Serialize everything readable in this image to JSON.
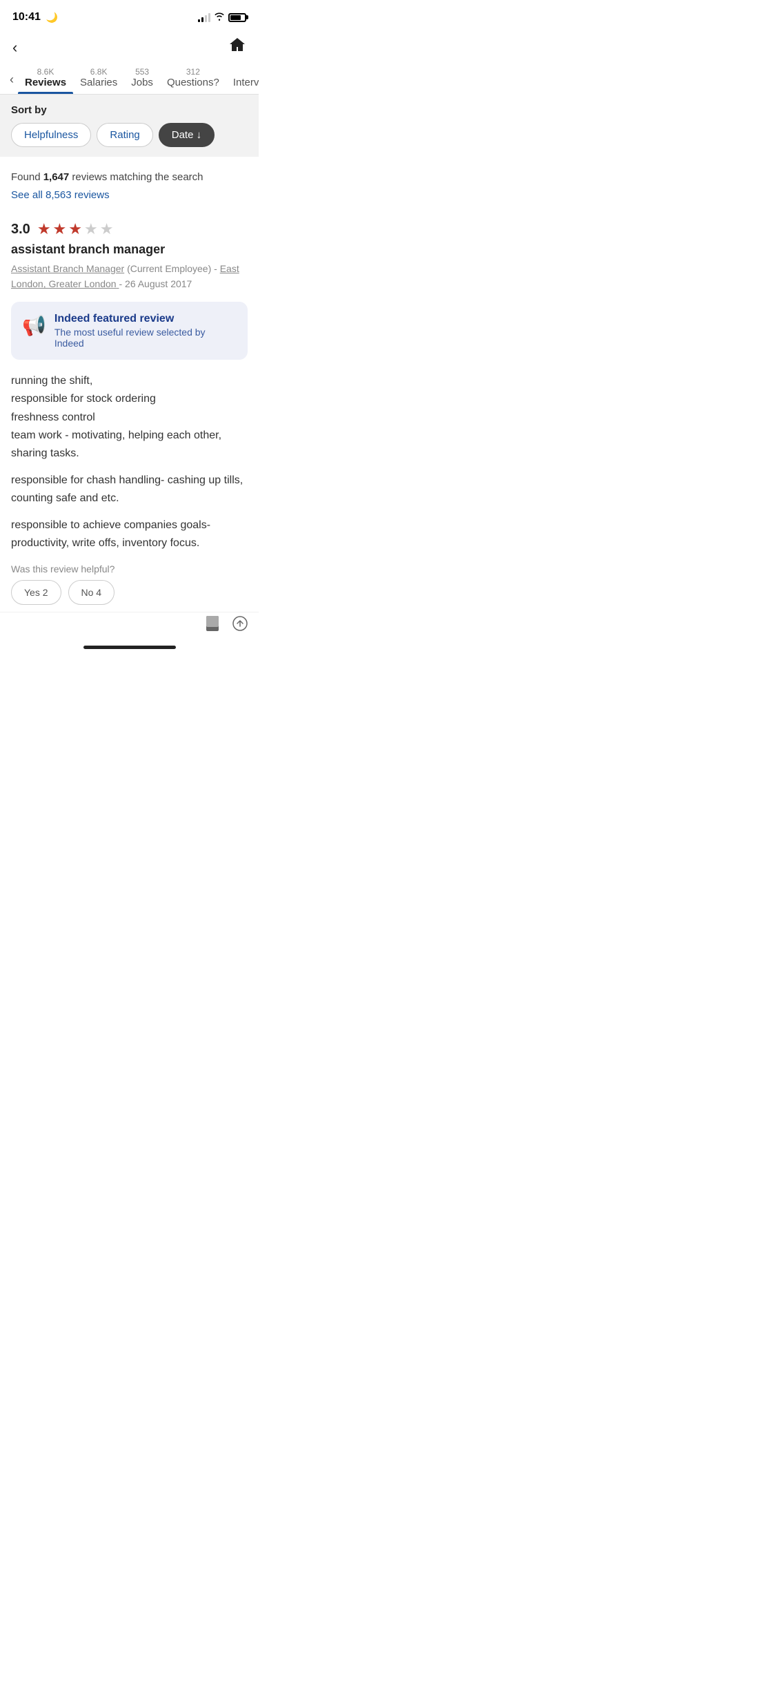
{
  "statusBar": {
    "time": "10:41",
    "moonIcon": "🌙"
  },
  "nav": {
    "backLabel": "‹",
    "homeIcon": "⌂"
  },
  "tabs": {
    "leftArrowLabel": "‹",
    "rightArrowLabel": "›",
    "items": [
      {
        "id": "reviews",
        "count": "8.6K",
        "label": "Reviews",
        "active": true
      },
      {
        "id": "salaries",
        "count": "6.8K",
        "label": "Salaries",
        "active": false
      },
      {
        "id": "jobs",
        "count": "553",
        "label": "Jobs",
        "active": false
      },
      {
        "id": "questions",
        "count": "312",
        "label": "Questions?",
        "active": false
      },
      {
        "id": "interviews",
        "count": "",
        "label": "Intervie",
        "active": false
      }
    ]
  },
  "sortBar": {
    "sortByLabel": "Sort by",
    "buttons": [
      {
        "id": "helpfulness",
        "label": "Helpfulness",
        "active": false
      },
      {
        "id": "rating",
        "label": "Rating",
        "active": false
      },
      {
        "id": "date",
        "label": "Date ↓",
        "active": true
      }
    ]
  },
  "results": {
    "foundText": "Found ",
    "matchCount": "1,647",
    "matchSuffix": " reviews matching the search",
    "seeAllLink": "See all 8,563 reviews"
  },
  "review": {
    "rating": "3.0",
    "stars": [
      true,
      true,
      true,
      false,
      false
    ],
    "title": "assistant branch manager",
    "reviewerRole": "Assistant Branch Manager",
    "employeeStatus": "(Current Employee)",
    "location": "East London, Greater London",
    "date": "26 August 2017",
    "featuredTitle": "Indeed featured review",
    "featuredSubtitle": "The most useful review selected by Indeed",
    "bodyParagraphs": [
      "running the shift,\nresponsible for stock ordering\nfreshness control\nteam work - motivating, helping each other, sharing tasks.",
      "responsible for chash handling- cashing up tills, counting safe and etc.",
      "responsible to achieve companies goals- productivity, write offs, inventory focus."
    ],
    "helpfulQuestion": "Was this review helpful?",
    "yesLabel": "Yes 2",
    "noLabel": "No 4"
  }
}
